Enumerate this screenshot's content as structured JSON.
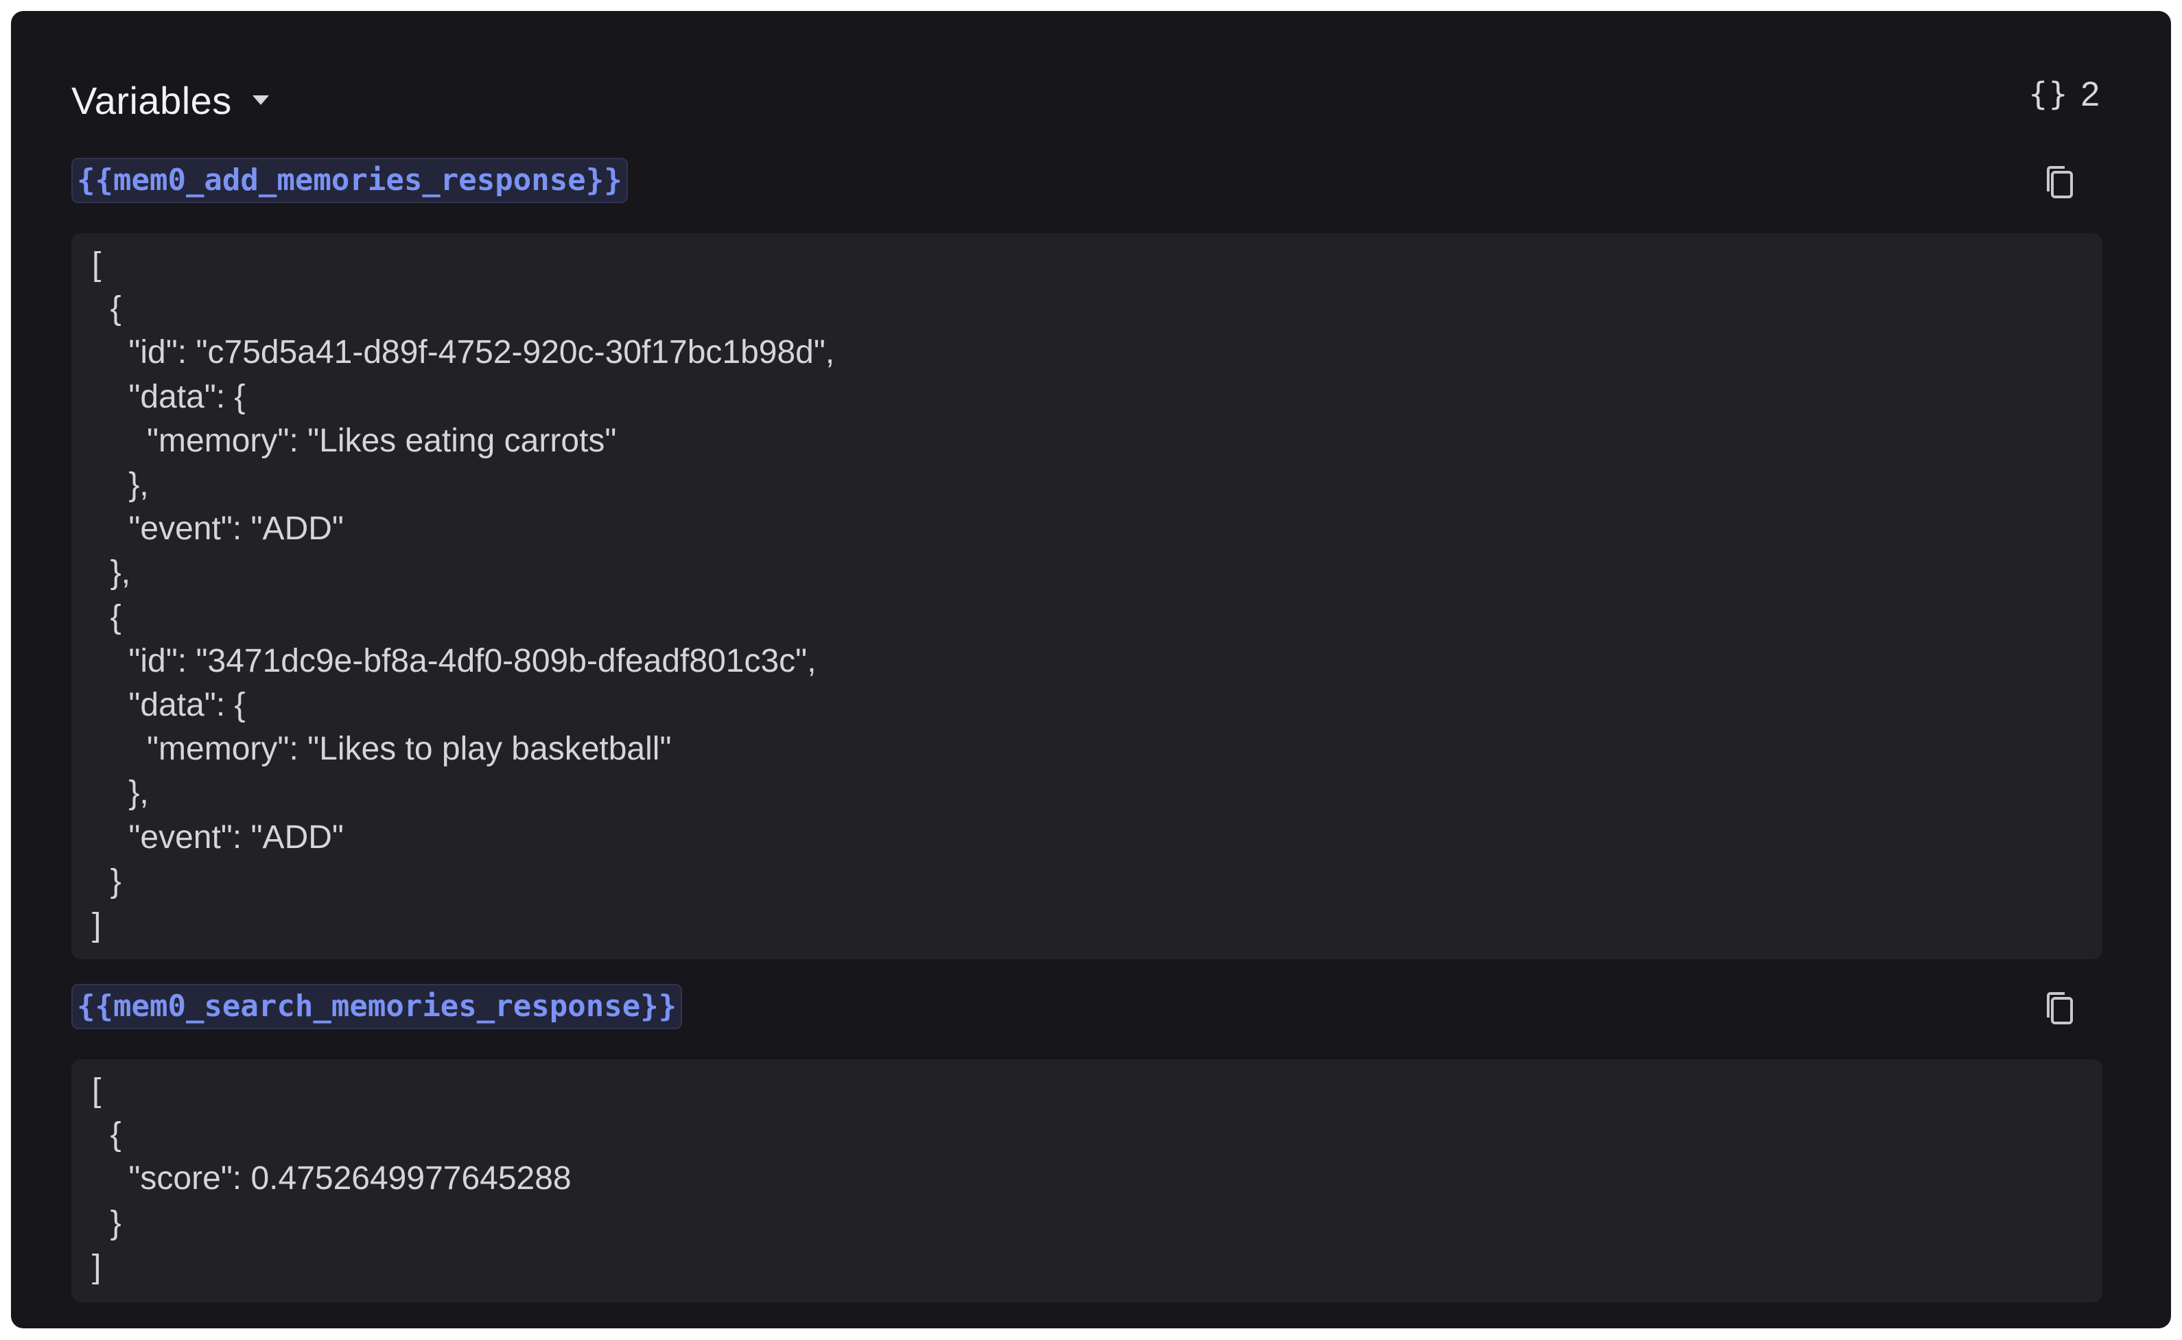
{
  "header": {
    "title": "Variables",
    "count_icon": "braces-icon",
    "count": "2"
  },
  "variables": [
    {
      "name": "{{mem0_add_memories_response}}",
      "copy_icon": "copy-icon",
      "value": "[\n  {\n    \"id\": \"c75d5a41-d89f-4752-920c-30f17bc1b98d\",\n    \"data\": {\n      \"memory\": \"Likes eating carrots\"\n    },\n    \"event\": \"ADD\"\n  },\n  {\n    \"id\": \"3471dc9e-bf8a-4df0-809b-dfeadf801c3c\",\n    \"data\": {\n      \"memory\": \"Likes to play basketball\"\n    },\n    \"event\": \"ADD\"\n  }\n]"
    },
    {
      "name": "{{mem0_search_memories_response}}",
      "copy_icon": "copy-icon",
      "value": "[\n  {\n    \"score\": 0.4752649977645288\n  }\n]"
    }
  ],
  "colors": {
    "background": "#17171b",
    "code_background": "#222226",
    "variable_accent": "#7b93f5"
  }
}
